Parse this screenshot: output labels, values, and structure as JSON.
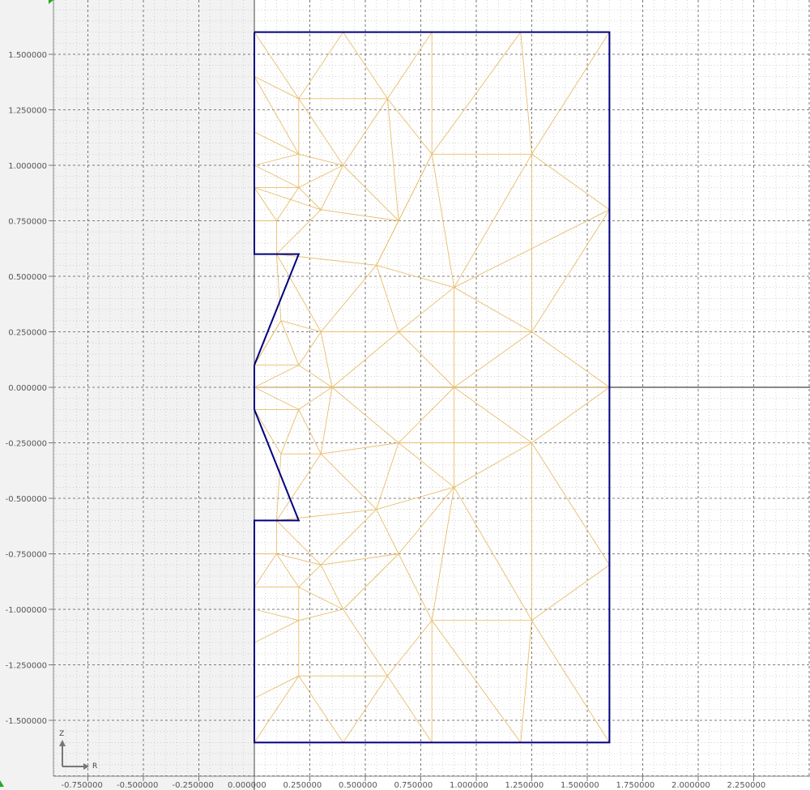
{
  "viewer": {
    "colors": {
      "background": "#ffffff",
      "axis_region": "#f2f2f2",
      "grid_major": "#555555",
      "grid_minor": "#b8b8b8",
      "axes": "#444444",
      "boundary": "#000080",
      "mesh": "#e8be6c"
    },
    "x_ticks": [
      "-0.750000",
      "-0.500000",
      "-0.250000",
      "0.000000",
      "0.250000",
      "0.500000",
      "0.750000",
      "1.000000",
      "1.250000",
      "1.500000",
      "1.750000",
      "2.000000",
      "2.250000"
    ],
    "y_ticks": [
      "1.500000",
      "1.250000",
      "1.000000",
      "0.750000",
      "0.500000",
      "0.250000",
      "0.000000",
      "-0.250000",
      "-0.500000",
      "-0.750000",
      "-1.000000",
      "-1.250000",
      "-1.500000"
    ],
    "triad": {
      "horizontal_label": "R",
      "vertical_label": "Z"
    },
    "boundary": [
      [
        0,
        1.6
      ],
      [
        1.6,
        1.6
      ],
      [
        1.6,
        -1.6
      ],
      [
        0,
        -1.6
      ],
      [
        0,
        -0.6
      ],
      [
        0.2,
        -0.6
      ],
      [
        0,
        -0.1
      ],
      [
        0,
        0.1
      ],
      [
        0.2,
        0.6
      ],
      [
        0,
        0.6
      ],
      [
        0,
        1.6
      ]
    ],
    "mesh_nodes": [
      [
        0,
        1.6
      ],
      [
        0.4,
        1.6
      ],
      [
        0.8,
        1.6
      ],
      [
        1.2,
        1.6
      ],
      [
        1.6,
        1.6
      ],
      [
        0,
        1.4
      ],
      [
        0.2,
        1.3
      ],
      [
        0.6,
        1.3
      ],
      [
        0,
        1.15
      ],
      [
        0.2,
        1.05
      ],
      [
        0.8,
        1.05
      ],
      [
        1.25,
        1.05
      ],
      [
        0,
        1.0
      ],
      [
        0.4,
        1.0
      ],
      [
        0,
        0.9
      ],
      [
        0.2,
        0.9
      ],
      [
        0.3,
        0.8
      ],
      [
        0.65,
        0.75
      ],
      [
        0,
        0.75
      ],
      [
        0.1,
        0.75
      ],
      [
        0.1,
        0.6
      ],
      [
        1.6,
        0.8
      ],
      [
        0.55,
        0.55
      ],
      [
        0.9,
        0.45
      ],
      [
        0.12,
        0.3
      ],
      [
        0.3,
        0.25
      ],
      [
        0.65,
        0.25
      ],
      [
        1.25,
        0.25
      ],
      [
        0,
        0.1
      ],
      [
        0.2,
        0.1
      ],
      [
        0.35,
        0.0
      ],
      [
        0.9,
        0.0
      ],
      [
        1.6,
        0.0
      ],
      [
        0.0,
        0.0
      ],
      [
        0,
        -0.1
      ],
      [
        0.2,
        -0.1
      ],
      [
        0.12,
        -0.3
      ],
      [
        0.3,
        -0.3
      ],
      [
        0.65,
        -0.25
      ],
      [
        1.25,
        -0.25
      ],
      [
        0.9,
        -0.45
      ],
      [
        0.55,
        -0.55
      ],
      [
        0.1,
        -0.6
      ],
      [
        0,
        -0.75
      ],
      [
        0.1,
        -0.75
      ],
      [
        0.3,
        -0.8
      ],
      [
        0.65,
        -0.75
      ],
      [
        0,
        -0.9
      ],
      [
        0.2,
        -0.9
      ],
      [
        0,
        -1.0
      ],
      [
        0.4,
        -1.0
      ],
      [
        0.8,
        -1.05
      ],
      [
        1.25,
        -1.05
      ],
      [
        1.6,
        -0.8
      ],
      [
        0,
        -1.15
      ],
      [
        0.2,
        -1.05
      ],
      [
        0,
        -1.4
      ],
      [
        0.2,
        -1.3
      ],
      [
        0.6,
        -1.3
      ],
      [
        0,
        -1.6
      ],
      [
        0.4,
        -1.6
      ],
      [
        0.8,
        -1.6
      ],
      [
        1.2,
        -1.6
      ],
      [
        1.6,
        -1.6
      ]
    ],
    "mesh_edges": [
      [
        0,
        6
      ],
      [
        1,
        6
      ],
      [
        1,
        7
      ],
      [
        2,
        7
      ],
      [
        2,
        10
      ],
      [
        3,
        10
      ],
      [
        3,
        11
      ],
      [
        4,
        11
      ],
      [
        5,
        6
      ],
      [
        6,
        7
      ],
      [
        7,
        10
      ],
      [
        10,
        11
      ],
      [
        11,
        21
      ],
      [
        6,
        9
      ],
      [
        6,
        13
      ],
      [
        7,
        13
      ],
      [
        7,
        17
      ],
      [
        10,
        17
      ],
      [
        8,
        9
      ],
      [
        5,
        9
      ],
      [
        9,
        13
      ],
      [
        12,
        9
      ],
      [
        12,
        15
      ],
      [
        14,
        15
      ],
      [
        9,
        15
      ],
      [
        13,
        15
      ],
      [
        13,
        16
      ],
      [
        13,
        17
      ],
      [
        15,
        16
      ],
      [
        14,
        16
      ],
      [
        18,
        19
      ],
      [
        19,
        15
      ],
      [
        19,
        20
      ],
      [
        16,
        20
      ],
      [
        16,
        17
      ],
      [
        17,
        22
      ],
      [
        10,
        22
      ],
      [
        10,
        23
      ],
      [
        11,
        23
      ],
      [
        11,
        27
      ],
      [
        21,
        23
      ],
      [
        21,
        27
      ],
      [
        20,
        22
      ],
      [
        22,
        23
      ],
      [
        20,
        24
      ],
      [
        24,
        25
      ],
      [
        20,
        25
      ],
      [
        22,
        25
      ],
      [
        22,
        26
      ],
      [
        23,
        26
      ],
      [
        25,
        26
      ],
      [
        23,
        27
      ],
      [
        26,
        27
      ],
      [
        27,
        32
      ],
      [
        23,
        31
      ],
      [
        26,
        31
      ],
      [
        27,
        31
      ],
      [
        31,
        32
      ],
      [
        24,
        28
      ],
      [
        24,
        29
      ],
      [
        25,
        29
      ],
      [
        28,
        29
      ],
      [
        29,
        30
      ],
      [
        25,
        30
      ],
      [
        26,
        30
      ],
      [
        30,
        31
      ],
      [
        33,
        29
      ],
      [
        33,
        30
      ],
      [
        34,
        35
      ],
      [
        35,
        30
      ],
      [
        33,
        35
      ],
      [
        35,
        36
      ],
      [
        36,
        37
      ],
      [
        35,
        37
      ],
      [
        37,
        30
      ],
      [
        37,
        38
      ],
      [
        30,
        38
      ],
      [
        38,
        31
      ],
      [
        38,
        39
      ],
      [
        31,
        39
      ],
      [
        39,
        32
      ],
      [
        38,
        40
      ],
      [
        39,
        40
      ],
      [
        31,
        40
      ],
      [
        40,
        41
      ],
      [
        37,
        41
      ],
      [
        38,
        41
      ],
      [
        36,
        42
      ],
      [
        37,
        42
      ],
      [
        41,
        42
      ],
      [
        42,
        44
      ],
      [
        43,
        44
      ],
      [
        42,
        45
      ],
      [
        44,
        45
      ],
      [
        41,
        45
      ],
      [
        41,
        46
      ],
      [
        40,
        46
      ],
      [
        45,
        46
      ],
      [
        44,
        48
      ],
      [
        47,
        48
      ],
      [
        45,
        48
      ],
      [
        48,
        50
      ],
      [
        45,
        50
      ],
      [
        46,
        50
      ],
      [
        46,
        51
      ],
      [
        40,
        51
      ],
      [
        40,
        52
      ],
      [
        39,
        52
      ],
      [
        39,
        53
      ],
      [
        52,
        53
      ],
      [
        51,
        52
      ],
      [
        49,
        55
      ],
      [
        54,
        55
      ],
      [
        48,
        55
      ],
      [
        55,
        50
      ],
      [
        55,
        57
      ],
      [
        56,
        57
      ],
      [
        50,
        58
      ],
      [
        57,
        58
      ],
      [
        51,
        58
      ],
      [
        57,
        59
      ],
      [
        57,
        60
      ],
      [
        58,
        60
      ],
      [
        58,
        61
      ],
      [
        51,
        61
      ],
      [
        51,
        62
      ],
      [
        52,
        62
      ],
      [
        52,
        63
      ],
      [
        53,
        63
      ],
      [
        19,
        14
      ],
      [
        44,
        47
      ],
      [
        36,
        34
      ],
      [
        24,
        28
      ]
    ]
  }
}
